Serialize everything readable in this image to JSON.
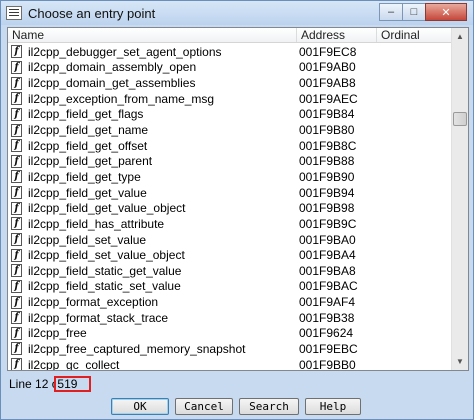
{
  "window": {
    "title": "Choose an entry point",
    "minimize_glyph": "–",
    "maximize_glyph": "□",
    "close_glyph": "✕"
  },
  "columns": [
    "Name",
    "Address",
    "Ordinal"
  ],
  "rows": [
    {
      "name": "il2cpp_debugger_set_agent_options",
      "address": "001F9EC8"
    },
    {
      "name": "il2cpp_domain_assembly_open",
      "address": "001F9AB0"
    },
    {
      "name": "il2cpp_domain_get_assemblies",
      "address": "001F9AB8"
    },
    {
      "name": "il2cpp_exception_from_name_msg",
      "address": "001F9AEC"
    },
    {
      "name": "il2cpp_field_get_flags",
      "address": "001F9B84"
    },
    {
      "name": "il2cpp_field_get_name",
      "address": "001F9B80"
    },
    {
      "name": "il2cpp_field_get_offset",
      "address": "001F9B8C"
    },
    {
      "name": "il2cpp_field_get_parent",
      "address": "001F9B88"
    },
    {
      "name": "il2cpp_field_get_type",
      "address": "001F9B90"
    },
    {
      "name": "il2cpp_field_get_value",
      "address": "001F9B94"
    },
    {
      "name": "il2cpp_field_get_value_object",
      "address": "001F9B98"
    },
    {
      "name": "il2cpp_field_has_attribute",
      "address": "001F9B9C"
    },
    {
      "name": "il2cpp_field_set_value",
      "address": "001F9BA0"
    },
    {
      "name": "il2cpp_field_set_value_object",
      "address": "001F9BA4"
    },
    {
      "name": "il2cpp_field_static_get_value",
      "address": "001F9BA8"
    },
    {
      "name": "il2cpp_field_static_set_value",
      "address": "001F9BAC"
    },
    {
      "name": "il2cpp_format_exception",
      "address": "001F9AF4"
    },
    {
      "name": "il2cpp_format_stack_trace",
      "address": "001F9B38"
    },
    {
      "name": "il2cpp_free",
      "address": "001F9624"
    },
    {
      "name": "il2cpp_free_captured_memory_snapshot",
      "address": "001F9EBC"
    },
    {
      "name": "il2cpp_gc_collect",
      "address": "001F9BB0"
    }
  ],
  "row_icon_glyph": "f",
  "scrollbar": {
    "up_glyph": "▲",
    "down_glyph": "▼"
  },
  "status": {
    "prefix": "Line 12 o",
    "total": "519"
  },
  "buttons": {
    "ok": "OK",
    "cancel": "Cancel",
    "search": "Search",
    "help": "Help"
  },
  "colors": {
    "highlight_box": "#e02020",
    "window_bg": "#c8daf0"
  }
}
